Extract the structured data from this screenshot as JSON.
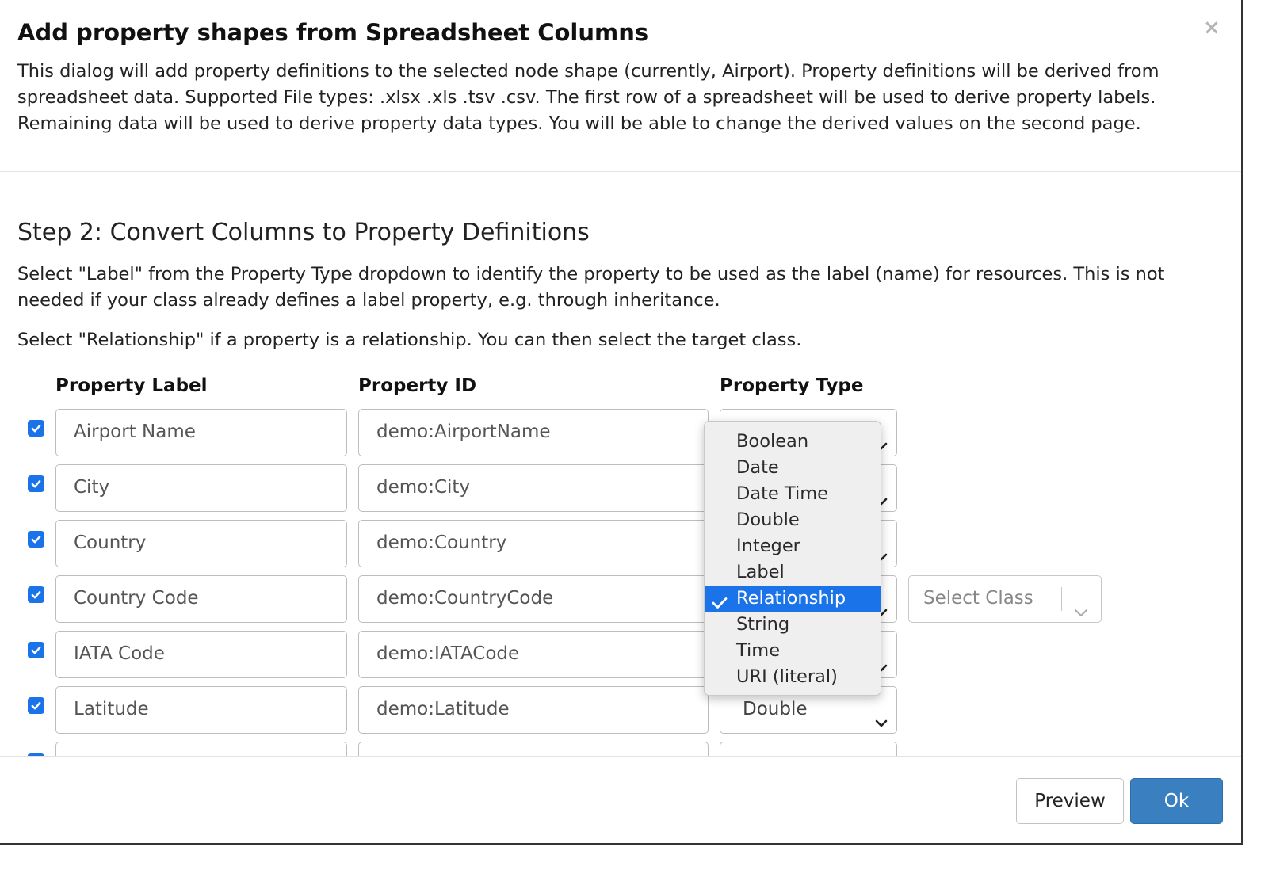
{
  "dialog": {
    "title": "Add property shapes from Spreadsheet Columns",
    "close_glyph": "×",
    "intro": "This dialog will add property definitions to the selected node shape (currently, Airport). Property definitions will be derived from spreadsheet data. Supported File types: .xlsx .xls .tsv .csv. The first row of a spreadsheet will be used to derive property labels. Remaining data will be used to derive property data types. You will be able to change the derived values on the second page."
  },
  "step": {
    "title": "Step 2: Convert Columns to Property Definitions",
    "para1": "Select \"Label\" from the Property Type dropdown to identify the property to be used as the label (name) for resources. This is not needed if your class already defines a label property, e.g. through inheritance.",
    "para2": "Select \"Relationship\" if a property is a relationship. You can then select the target class."
  },
  "table": {
    "headers": {
      "label": "Property Label",
      "id": "Property ID",
      "type": "Property Type"
    },
    "rows": [
      {
        "checked": true,
        "label": "Airport Name",
        "id": "demo:AirportName",
        "type": ""
      },
      {
        "checked": true,
        "label": "City",
        "id": "demo:City",
        "type": ""
      },
      {
        "checked": true,
        "label": "Country",
        "id": "demo:Country",
        "type": ""
      },
      {
        "checked": true,
        "label": "Country Code",
        "id": "demo:CountryCode",
        "type": "",
        "class_placeholder": "Select Class"
      },
      {
        "checked": true,
        "label": "IATA Code",
        "id": "demo:IATACode",
        "type": ""
      },
      {
        "checked": true,
        "label": "Latitude",
        "id": "demo:Latitude",
        "type": "Double"
      },
      {
        "checked": true,
        "label": "",
        "id": "",
        "type": ""
      }
    ]
  },
  "type_menu": {
    "options": [
      "Boolean",
      "Date",
      "Date Time",
      "Double",
      "Integer",
      "Label",
      "Relationship",
      "String",
      "Time",
      "URI (literal)"
    ],
    "selected": "Relationship"
  },
  "footer": {
    "preview_label": "Preview",
    "ok_label": "Ok"
  },
  "colors": {
    "accent": "#1a73e8",
    "ok_button": "#3a7fbf"
  }
}
